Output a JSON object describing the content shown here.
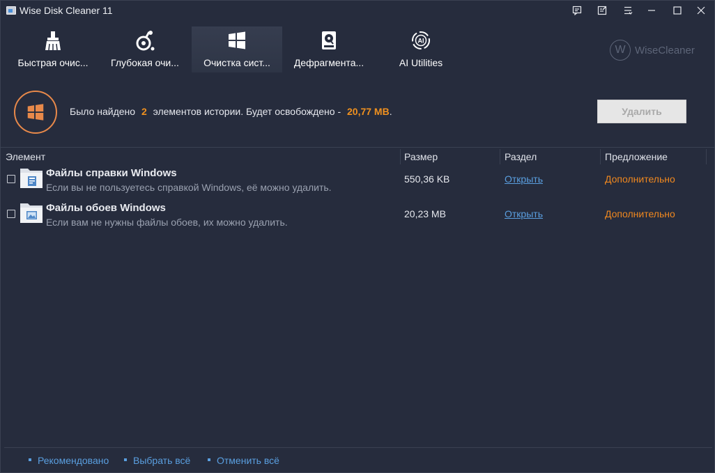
{
  "window": {
    "title": "Wise Disk Cleaner 11"
  },
  "toolbar": {
    "tabs": [
      {
        "label": "Быстрая очис...",
        "icon": "broom-icon"
      },
      {
        "label": "Глубокая очи...",
        "icon": "vacuum-icon"
      },
      {
        "label": "Очистка сист...",
        "icon": "windows-icon",
        "active": true
      },
      {
        "label": "Дефрагмента...",
        "icon": "disk-icon"
      },
      {
        "label": "AI Utilities",
        "icon": "ai-icon"
      }
    ],
    "brand": "WiseCleaner",
    "brand_mark": "W"
  },
  "summary": {
    "prefix": "Было найдено",
    "count": "2",
    "middle": "элементов истории. Будет освобождено -",
    "size": "20,77 MB",
    "suffix": ".",
    "delete_label": "Удалить"
  },
  "table": {
    "headers": {
      "element": "Элемент",
      "size": "Размер",
      "section": "Раздел",
      "suggestion": "Предложение"
    },
    "rows": [
      {
        "title": "Файлы справки Windows",
        "description": "Если вы не пользуетесь справкой Windows, её можно удалить.",
        "size": "550,36 KB",
        "section": "Открыть",
        "suggestion": "Дополнительно",
        "checked": false
      },
      {
        "title": "Файлы обоев Windows",
        "description": "Если вам не нужны файлы обоев, их можно удалить.",
        "size": "20,23 MB",
        "section": "Открыть",
        "suggestion": "Дополнительно",
        "checked": false
      }
    ]
  },
  "footer": {
    "recommended": "Рекомендовано",
    "select_all": "Выбрать всё",
    "deselect_all": "Отменить всё"
  },
  "colors": {
    "background": "#262c3d",
    "accent_orange": "#f0911f",
    "link_blue": "#5a9fe0"
  }
}
